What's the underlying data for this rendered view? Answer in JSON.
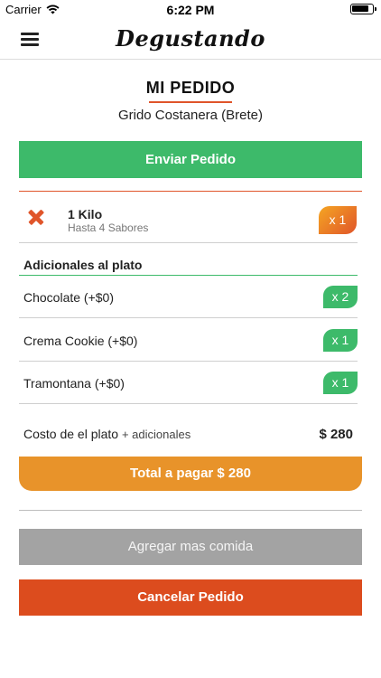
{
  "status_bar": {
    "carrier": "Carrier",
    "time": "6:22 PM",
    "wifi_icon": "wifi-icon",
    "battery_icon": "battery-icon"
  },
  "nav": {
    "menu_icon": "hamburger-menu-icon",
    "logo": "Degustando"
  },
  "page": {
    "title": "MI PEDIDO",
    "restaurant": "Grido Costanera (Brete)"
  },
  "buttons": {
    "send": "Enviar Pedido",
    "total": "Total a pagar $ 280",
    "add_more": "Agregar mas comida",
    "cancel": "Cancelar Pedido"
  },
  "order_item": {
    "name": "1 Kilo",
    "description": "Hasta 4 Sabores",
    "quantity": "x 1",
    "remove_icon": "remove-x-icon"
  },
  "addons": {
    "title": "Adicionales al plato",
    "items": [
      {
        "label": "Chocolate (+$0)",
        "quantity": "x 2"
      },
      {
        "label": "Crema Cookie (+$0)",
        "quantity": "x 1"
      },
      {
        "label": "Tramontana (+$0)",
        "quantity": "x 1"
      }
    ]
  },
  "cost": {
    "label": "Costo de el plato",
    "extra": "+ adicionales",
    "value": "$ 280"
  },
  "colors": {
    "green": "#3dba6a",
    "orange": "#e8932a",
    "red": "#dc4c1e",
    "gray": "#a3a3a3"
  }
}
